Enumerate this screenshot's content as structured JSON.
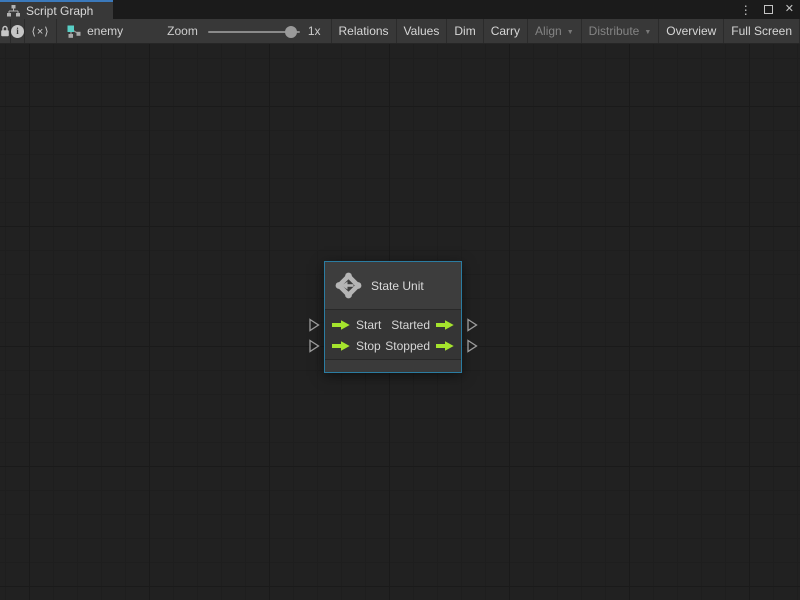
{
  "window": {
    "tab_label": "Script Graph",
    "controls": {
      "menu_glyph": "⋮",
      "close_glyph": "✕"
    }
  },
  "toolbar": {
    "info_glyph": "i",
    "code_toggle_glyph": "⟨×⟩",
    "graph_name": "enemy",
    "zoom": {
      "label": "Zoom",
      "value": "1x"
    },
    "dropdown_glyph": "▼",
    "buttons": [
      {
        "label": "Relations",
        "enabled": true,
        "dropdown": false
      },
      {
        "label": "Values",
        "enabled": true,
        "dropdown": false
      },
      {
        "label": "Dim",
        "enabled": true,
        "dropdown": false
      },
      {
        "label": "Carry",
        "enabled": true,
        "dropdown": false
      },
      {
        "label": "Align",
        "enabled": false,
        "dropdown": true
      },
      {
        "label": "Distribute",
        "enabled": false,
        "dropdown": true
      },
      {
        "label": "Overview",
        "enabled": true,
        "dropdown": false
      },
      {
        "label": "Full Screen",
        "enabled": true,
        "dropdown": false
      }
    ]
  },
  "node": {
    "title": "State Unit",
    "rows": [
      {
        "input": "Start",
        "output": "Started"
      },
      {
        "input": "Stop",
        "output": "Stopped"
      }
    ]
  },
  "colors": {
    "selection_border": "#2b7ca1",
    "port_green": "#a5e42d",
    "tab_accent": "#3b79bb",
    "canvas_bg": "#212121",
    "toolbar_bg": "#383838"
  }
}
